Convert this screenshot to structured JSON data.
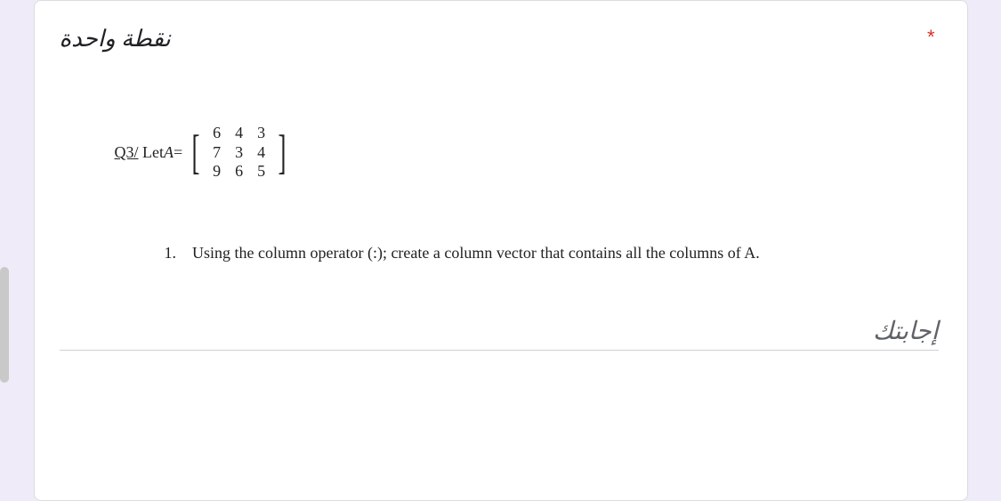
{
  "header": {
    "points_label": "نقطة واحدة",
    "required": "*"
  },
  "question": {
    "q_number_label": "Q3/",
    "let_label": "Let ",
    "var_name": "A",
    "equals": " = ",
    "matrix": {
      "r1c1": "6",
      "r1c2": "4",
      "r1c3": "3",
      "r2c1": "7",
      "r2c2": "3",
      "r2c3": "4",
      "r3c1": "9",
      "r3c2": "6",
      "r3c3": "5"
    },
    "instruction_number": "1.",
    "instruction_text": "Using the column operator (:); create a column vector that contains all the columns of A."
  },
  "answer": {
    "label": "إجابتك"
  }
}
